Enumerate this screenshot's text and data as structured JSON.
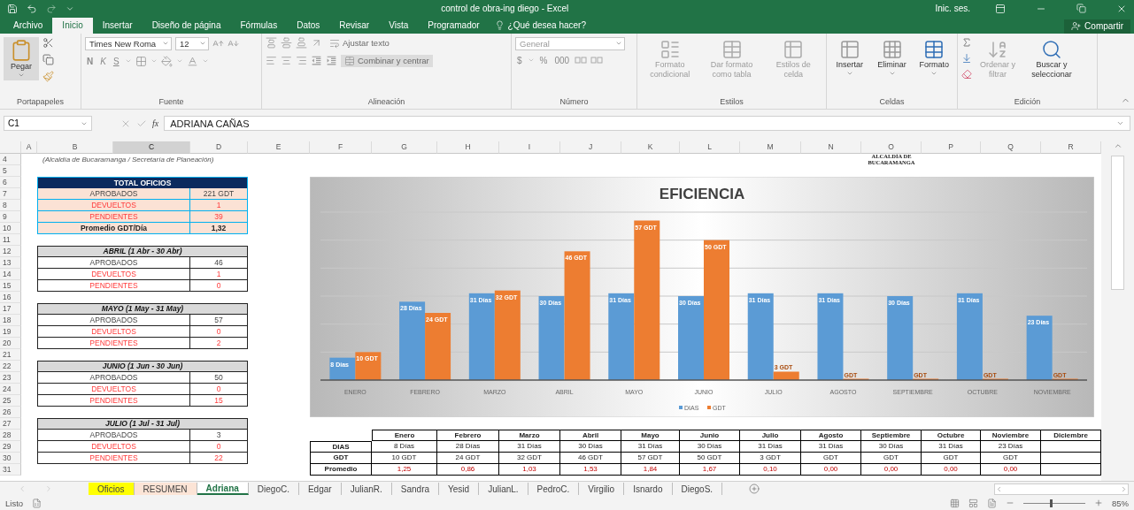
{
  "title_bar": {
    "title": "control de obra-ing diego  -  Excel",
    "sign_in": "Inic. ses."
  },
  "ribbon_tabs": [
    {
      "label": "Archivo",
      "selected": false
    },
    {
      "label": "Inicio",
      "selected": true
    },
    {
      "label": "Insertar",
      "selected": false
    },
    {
      "label": "Diseño de página",
      "selected": false
    },
    {
      "label": "Fórmulas",
      "selected": false
    },
    {
      "label": "Datos",
      "selected": false
    },
    {
      "label": "Revisar",
      "selected": false
    },
    {
      "label": "Vista",
      "selected": false
    },
    {
      "label": "Programador",
      "selected": false
    }
  ],
  "tell_me": "¿Qué desea hacer?",
  "share": "Compartir",
  "ribbon": {
    "clipboard": {
      "paste": "Pegar",
      "group": "Portapapeles"
    },
    "font": {
      "name": "Times New Roma",
      "size": "12",
      "bold": "N",
      "italic": "K",
      "underline": "S",
      "group": "Fuente"
    },
    "alignment": {
      "wrap": {
        "label": "Ajustar texto",
        "disabled": true
      },
      "merge": {
        "label": "Combinar y centrar",
        "disabled": true
      },
      "group": "Alineación"
    },
    "number": {
      "format": "General",
      "currency": "$",
      "percent": "%",
      "thousands": "000",
      "group": "Número"
    },
    "styles": {
      "buttons": [
        {
          "label": "Formato condicional",
          "disabled": true
        },
        {
          "label": "Dar formato como tabla",
          "disabled": true
        },
        {
          "label": "Estilos de celda",
          "disabled": true
        }
      ],
      "group": "Estilos"
    },
    "cells": {
      "buttons": [
        {
          "label": "Insertar",
          "disabled": false
        },
        {
          "label": "Eliminar",
          "disabled": false
        },
        {
          "label": "Formato",
          "disabled": false
        }
      ],
      "group": "Celdas"
    },
    "editing": {
      "buttons": [
        {
          "label": "Ordenar y filtrar",
          "disabled": true
        },
        {
          "label": "Buscar y seleccionar",
          "disabled": false
        }
      ],
      "group": "Edición"
    }
  },
  "formula_bar": {
    "name_box": "C1",
    "fx": "fx",
    "value": "ADRIANA CAÑAS"
  },
  "sheet": {
    "column_headers": [
      {
        "label": "A",
        "selected": false
      },
      {
        "label": "B",
        "selected": false
      },
      {
        "label": "C",
        "selected": true
      },
      {
        "label": "D",
        "selected": false
      },
      {
        "label": "E",
        "selected": false
      },
      {
        "label": "F",
        "selected": false
      },
      {
        "label": "G",
        "selected": false
      },
      {
        "label": "H",
        "selected": false
      },
      {
        "label": "I",
        "selected": false
      },
      {
        "label": "J",
        "selected": false
      },
      {
        "label": "K",
        "selected": false
      },
      {
        "label": "L",
        "selected": false
      },
      {
        "label": "M",
        "selected": false
      },
      {
        "label": "N",
        "selected": false
      },
      {
        "label": "O",
        "selected": false
      },
      {
        "label": "P",
        "selected": false
      },
      {
        "label": "Q",
        "selected": false
      },
      {
        "label": "R",
        "selected": false
      }
    ],
    "row_numbers": [
      "4",
      "5",
      "6",
      "7",
      "8",
      "9",
      "10",
      "11",
      "12",
      "13",
      "14",
      "15",
      "16",
      "17",
      "18",
      "19",
      "20",
      "21",
      "22",
      "23",
      "24",
      "25",
      "26",
      "27",
      "28",
      "29",
      "30",
      "31"
    ],
    "subtitle": "(Alcaldía de Bucaramanga / Secretaría de Planeación)",
    "logo_text": "ALCALDÍA DE BUCARAMANGA",
    "total": {
      "title": "TOTAL OFICIOS",
      "rows": [
        {
          "kind": "approved",
          "label": "APROBADOS",
          "value": "221 GDT"
        },
        {
          "kind": "returned",
          "label": "DEVUELTOS",
          "value": "1"
        },
        {
          "kind": "pending",
          "label": "PENDIENTES",
          "value": "39"
        },
        {
          "kind": "average",
          "label": "Promedio GDT/Día",
          "value": "1,32"
        }
      ]
    },
    "months": [
      {
        "title": "ABRIL (1 Abr - 30 Abr)",
        "rows": [
          {
            "kind": "approved",
            "label": "APROBADOS",
            "value": "46"
          },
          {
            "kind": "returned",
            "label": "DEVUELTOS",
            "value": "1"
          },
          {
            "kind": "pending",
            "label": "PENDIENTES",
            "value": "0"
          }
        ]
      },
      {
        "title": "MAYO (1 May - 31 May)",
        "rows": [
          {
            "kind": "approved",
            "label": "APROBADOS",
            "value": "57"
          },
          {
            "kind": "returned",
            "label": "DEVUELTOS",
            "value": "0"
          },
          {
            "kind": "pending",
            "label": "PENDIENTES",
            "value": "2"
          }
        ]
      },
      {
        "title": "JUNIO (1 Jun - 30 Jun)",
        "rows": [
          {
            "kind": "approved",
            "label": "APROBADOS",
            "value": "50"
          },
          {
            "kind": "returned",
            "label": "DEVUELTOS",
            "value": "0"
          },
          {
            "kind": "pending",
            "label": "PENDIENTES",
            "value": "15"
          }
        ]
      },
      {
        "title": "JULIO (1 Jul - 31 Jul)",
        "rows": [
          {
            "kind": "approved",
            "label": "APROBADOS",
            "value": "3"
          },
          {
            "kind": "returned",
            "label": "DEVUELTOS",
            "value": "0"
          },
          {
            "kind": "pending",
            "label": "PENDIENTES",
            "value": "22"
          }
        ]
      }
    ],
    "chart": {
      "chart_data": {
        "type": "bar",
        "title": "EFICIENCIA",
        "categories": [
          "ENERO",
          "FEBRERO",
          "MARZO",
          "ABRIL",
          "MAYO",
          "JUNIO",
          "JULIO",
          "AGOSTO",
          "SEPTIEMBRE",
          "OCTUBRE",
          "NOVIEMBRE"
        ],
        "series": [
          {
            "name": "DIAS",
            "color": "#5b9bd5",
            "values": [
              8,
              28,
              31,
              30,
              31,
              30,
              31,
              31,
              30,
              31,
              23
            ],
            "value_labels": [
              "8 Días",
              "28 Días",
              "31 Días",
              "30 Días",
              "31 Días",
              "30 Días",
              "31 Días",
              "31 Días",
              "30 Días",
              "31 Días",
              "23 Días"
            ]
          },
          {
            "name": "GDT",
            "color": "#ed7d31",
            "values": [
              10,
              24,
              32,
              46,
              57,
              50,
              3,
              0,
              0,
              0,
              0
            ],
            "value_labels": [
              "10 GDT",
              "24 GDT",
              "32 GDT",
              "46 GDT",
              "57 GDT",
              "50 GDT",
              "3 GDT",
              "GDT",
              "GDT",
              "GDT",
              "GDT"
            ]
          }
        ],
        "legend": true
      }
    },
    "summary_table": {
      "columns": [
        "Enero",
        "Febrero",
        "Marzo",
        "Abril",
        "Mayo",
        "Junio",
        "Julio",
        "Agosto",
        "Septiembre",
        "Octubre",
        "Noviembre",
        "Diciembre"
      ],
      "rows": [
        {
          "kind": "days",
          "label": "DIAS",
          "cells": [
            "8 Días",
            "28 Días",
            "31 Días",
            "30 Días",
            "31 Días",
            "30 Días",
            "31 Días",
            "31 Días",
            "30 Días",
            "31 Días",
            "23 Días"
          ]
        },
        {
          "kind": "output",
          "label": "GDT",
          "cells": [
            "10 GDT",
            "24 GDT",
            "32 GDT",
            "46 GDT",
            "57 GDT",
            "50 GDT",
            "3 GDT",
            "GDT",
            "GDT",
            "GDT",
            "GDT"
          ]
        },
        {
          "kind": "average",
          "label": "Promedio",
          "cells": [
            "1,25",
            "0,86",
            "1,03",
            "1,53",
            "1,84",
            "1,67",
            "0,10",
            "0,00",
            "0,00",
            "0,00",
            "0,00"
          ]
        }
      ]
    }
  },
  "sheet_tabs": [
    {
      "label": "Oficios",
      "selected": false,
      "color": "#ffff00"
    },
    {
      "label": "RESUMEN",
      "selected": false,
      "color": "#fce4d6"
    },
    {
      "label": "Adriana",
      "selected": true
    },
    {
      "label": "DiegoC.",
      "selected": false
    },
    {
      "label": "Edgar",
      "selected": false
    },
    {
      "label": "JulianR.",
      "selected": false
    },
    {
      "label": "Sandra",
      "selected": false
    },
    {
      "label": "Yesid",
      "selected": false
    },
    {
      "label": "JulianL.",
      "selected": false
    },
    {
      "label": "PedroC.",
      "selected": false
    },
    {
      "label": "Virgilio",
      "selected": false
    },
    {
      "label": "Isnardo",
      "selected": false
    },
    {
      "label": "DiegoS.",
      "selected": false
    }
  ],
  "status_bar": {
    "status": "Listo",
    "zoom": {
      "level": 0.45,
      "reading": "85%"
    }
  }
}
